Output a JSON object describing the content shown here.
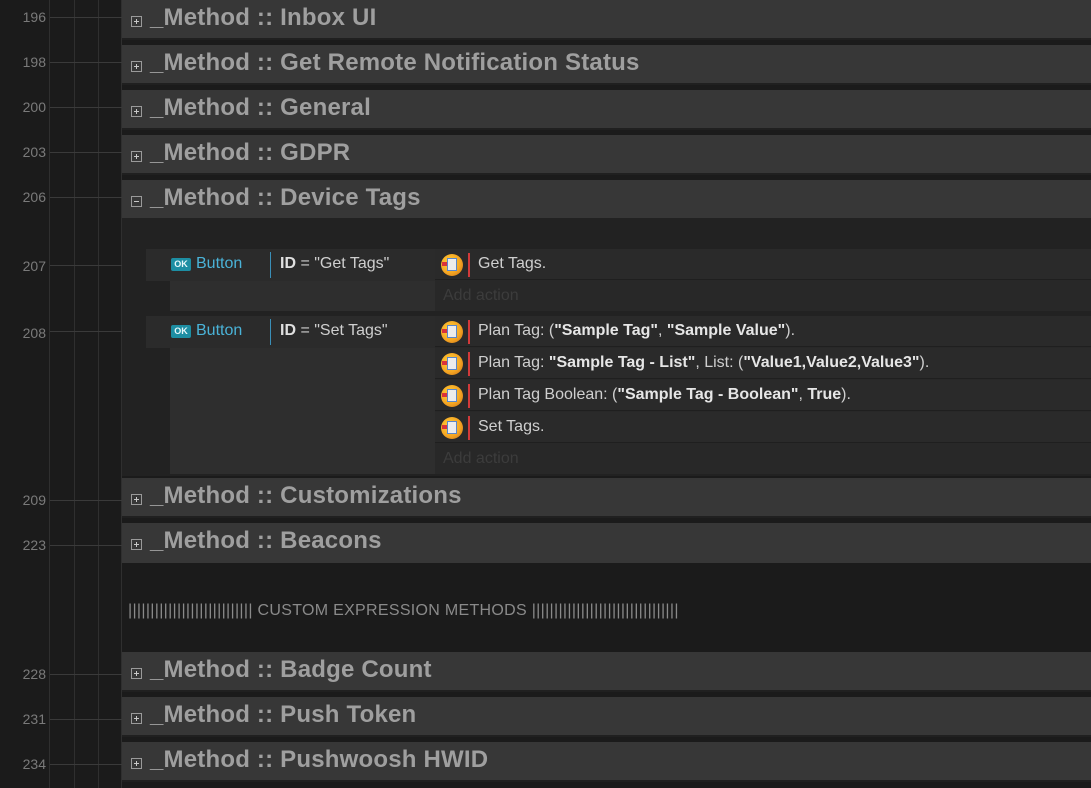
{
  "line_numbers": {
    "inbox": "196",
    "remote_status": "198",
    "general": "200",
    "gdpr": "203",
    "device_tags": "206",
    "event_get_tags": "207",
    "event_set_tags": "208",
    "customizations": "209",
    "beacons": "223",
    "badge_count": "228",
    "push_token": "231",
    "hwid": "234"
  },
  "groups": {
    "inbox": "_Method :: Inbox UI",
    "remote_status": "_Method :: Get Remote Notification Status",
    "general": "_Method :: General",
    "gdpr": "_Method :: GDPR",
    "device_tags": "_Method :: Device Tags",
    "customizations": "_Method :: Customizations",
    "beacons": "_Method :: Beacons",
    "badge_count": "_Method :: Badge Count",
    "push_token": "_Method :: Push Token",
    "hwid": "_Method :: Pushwoosh HWID"
  },
  "events": {
    "get_tags": {
      "badge": "OK",
      "object": "Button",
      "cond_key": "ID",
      "cond_rest": " = \"Get Tags\"",
      "actions": {
        "a1": {
          "text": "Get Tags."
        }
      },
      "add_action": "Add action"
    },
    "set_tags": {
      "badge": "OK",
      "object": "Button",
      "cond_key": "ID",
      "cond_rest": " = \"Set Tags\"",
      "actions": {
        "a1": {
          "p1": "Plan Tag: (",
          "b1": "\"Sample Tag\"",
          "p2": ", ",
          "b2": "\"Sample Value\"",
          "p3": ")."
        },
        "a2": {
          "p1": "Plan Tag: ",
          "b1": "\"Sample Tag - List\"",
          "p2": ", List: (",
          "b2": "\"Value1,Value2,Value3\"",
          "p3": ")."
        },
        "a3": {
          "p1": "Plan Tag Boolean: (",
          "b1": "\"Sample Tag - Boolean\"",
          "p2": ", ",
          "b2": "True",
          "p3": ")."
        },
        "a4": {
          "p1": "Set Tags."
        }
      },
      "add_action": "Add action"
    }
  },
  "comment": "|||||||||||||||||||||||||||| CUSTOM EXPRESSION METHODS |||||||||||||||||||||||||||||||||",
  "colors": {
    "background": "#1b1b1b",
    "group_bar": "#373737",
    "group_title": "#9f9f9f",
    "object_name": "#4ab3d8",
    "ok_badge": "#1d8ea3",
    "action_separator": "#d23a3a"
  },
  "icons": {
    "collapse": "plus-toggle-icon",
    "expand": "minus-toggle-icon",
    "action": "pushwoosh-plugin-icon"
  }
}
